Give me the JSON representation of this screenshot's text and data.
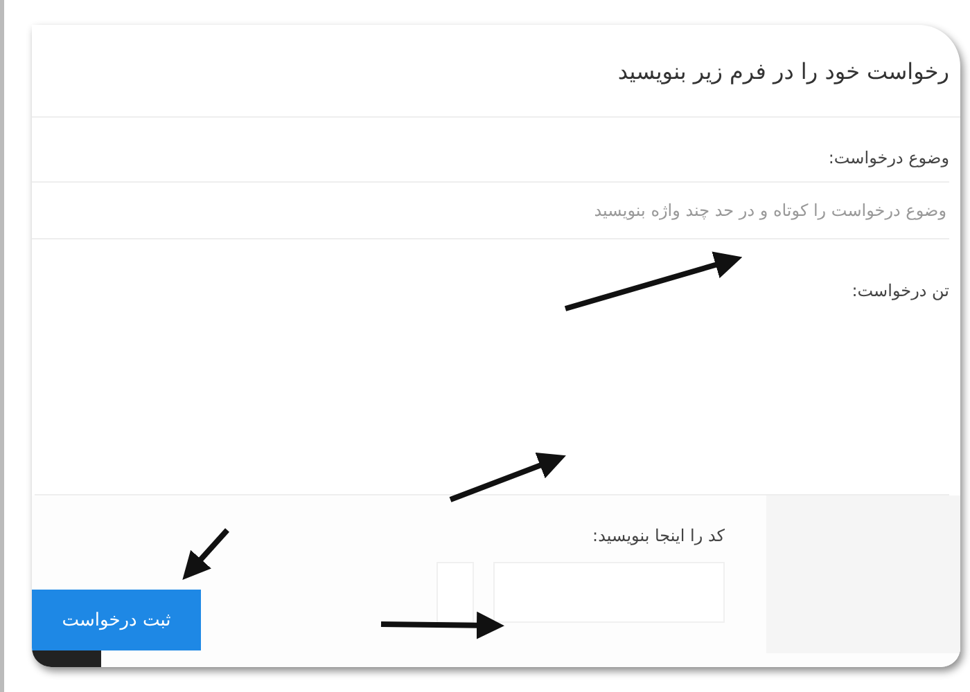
{
  "form": {
    "title": "رخواست خود را در فرم زیر بنویسید",
    "subject": {
      "label": "وضوع درخواست:",
      "placeholder": "وضوع درخواست را کوتاه و در حد چند واژه بنویسید"
    },
    "body": {
      "label": "تن درخواست:"
    },
    "captcha": {
      "label": "کد را اینجا بنویسید:"
    },
    "submit_button": "ثبت درخواست"
  }
}
